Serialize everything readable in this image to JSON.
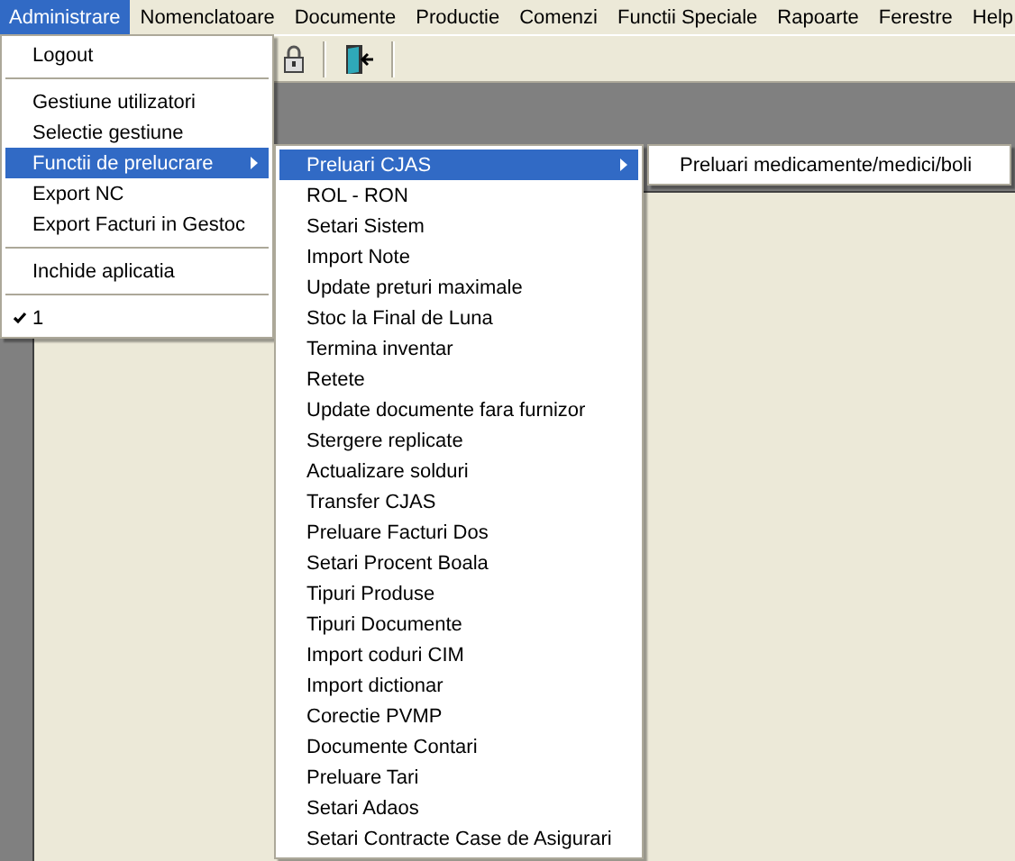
{
  "menubar": [
    {
      "label": "Administrare",
      "selected": true
    },
    {
      "label": "Nomenclatoare",
      "selected": false
    },
    {
      "label": "Documente",
      "selected": false
    },
    {
      "label": "Productie",
      "selected": false
    },
    {
      "label": "Comenzi",
      "selected": false
    },
    {
      "label": "Functii Speciale",
      "selected": false
    },
    {
      "label": "Rapoarte",
      "selected": false
    },
    {
      "label": "Ferestre",
      "selected": false
    },
    {
      "label": "Help",
      "selected": false
    }
  ],
  "menu": [
    {
      "kind": "item",
      "label": "Logout",
      "selected": false,
      "checked": false,
      "submenu": false
    },
    {
      "kind": "separator"
    },
    {
      "kind": "item",
      "label": "Gestiune utilizatori",
      "selected": false,
      "checked": false,
      "submenu": false
    },
    {
      "kind": "item",
      "label": "Selectie gestiune",
      "selected": false,
      "checked": false,
      "submenu": false
    },
    {
      "kind": "item",
      "label": "Functii de prelucrare",
      "selected": true,
      "checked": false,
      "submenu": true
    },
    {
      "kind": "item",
      "label": "Export NC",
      "selected": false,
      "checked": false,
      "submenu": false
    },
    {
      "kind": "item",
      "label": "Export Facturi in Gestoc",
      "selected": false,
      "checked": false,
      "submenu": false
    },
    {
      "kind": "separator"
    },
    {
      "kind": "item",
      "label": "Inchide aplicatia",
      "selected": false,
      "checked": false,
      "submenu": false
    },
    {
      "kind": "separator"
    },
    {
      "kind": "item",
      "label": "1",
      "selected": false,
      "checked": true,
      "submenu": false
    }
  ],
  "submenu": [
    {
      "label": "Preluari CJAS",
      "selected": true,
      "submenu": true
    },
    {
      "label": "ROL - RON",
      "selected": false,
      "submenu": false
    },
    {
      "label": "Setari Sistem",
      "selected": false,
      "submenu": false
    },
    {
      "label": "Import Note",
      "selected": false,
      "submenu": false
    },
    {
      "label": "Update preturi maximale",
      "selected": false,
      "submenu": false
    },
    {
      "label": "Stoc la Final de Luna",
      "selected": false,
      "submenu": false
    },
    {
      "label": "Termina inventar",
      "selected": false,
      "submenu": false
    },
    {
      "label": "Retete",
      "selected": false,
      "submenu": false
    },
    {
      "label": "Update documente fara furnizor",
      "selected": false,
      "submenu": false
    },
    {
      "label": "Stergere replicate",
      "selected": false,
      "submenu": false
    },
    {
      "label": "Actualizare solduri",
      "selected": false,
      "submenu": false
    },
    {
      "label": "Transfer CJAS",
      "selected": false,
      "submenu": false
    },
    {
      "label": "Preluare Facturi Dos",
      "selected": false,
      "submenu": false
    },
    {
      "label": "Setari Procent Boala",
      "selected": false,
      "submenu": false
    },
    {
      "label": "Tipuri Produse",
      "selected": false,
      "submenu": false
    },
    {
      "label": "Tipuri Documente",
      "selected": false,
      "submenu": false
    },
    {
      "label": "Import coduri CIM",
      "selected": false,
      "submenu": false
    },
    {
      "label": "Import dictionar",
      "selected": false,
      "submenu": false
    },
    {
      "label": "Corectie PVMP",
      "selected": false,
      "submenu": false
    },
    {
      "label": "Documente Contari",
      "selected": false,
      "submenu": false
    },
    {
      "label": "Preluare Tari",
      "selected": false,
      "submenu": false
    },
    {
      "label": "Setari Adaos",
      "selected": false,
      "submenu": false
    },
    {
      "label": "Setari Contracte Case de Asigurari",
      "selected": false,
      "submenu": false
    }
  ],
  "submenu2": [
    {
      "label": "Preluari medicamente/medici/boli",
      "selected": false
    }
  ]
}
